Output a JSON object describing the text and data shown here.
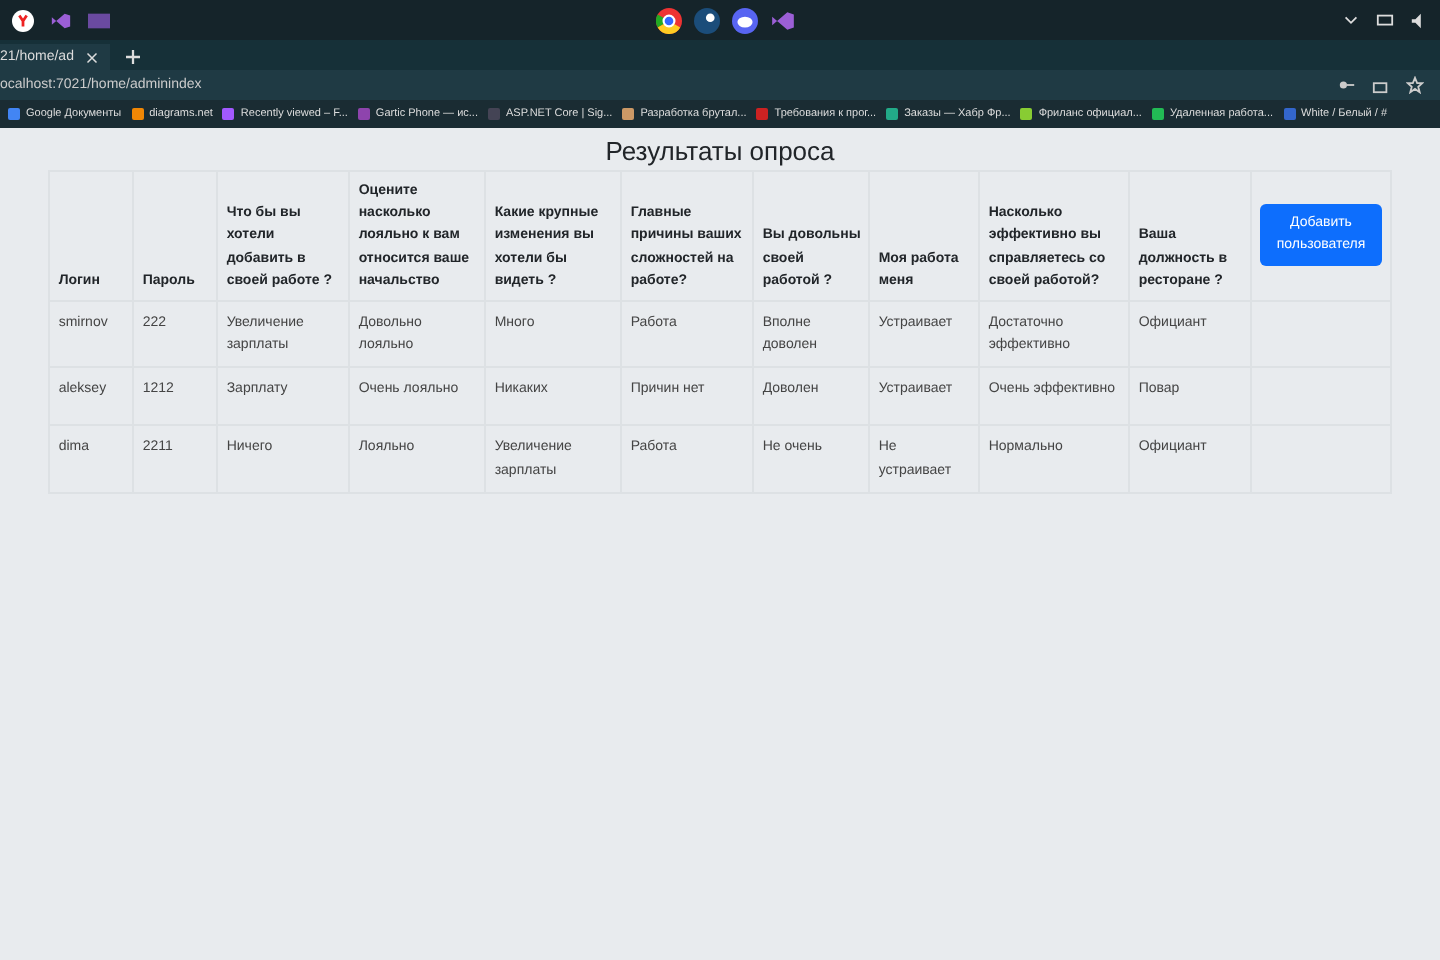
{
  "browser": {
    "tab_title": "21/home/ad",
    "address": "ocalhost:7021/home/adminindex",
    "bookmarks": [
      "Google Документы",
      "diagrams.net",
      "Recently viewed – F...",
      "Gartic Phone — ис...",
      "ASP.NET Core | Sig...",
      "Разработка брутал...",
      "Требования к прог...",
      "Заказы — Хабр Фр...",
      "Фриланс официал...",
      "Удаленная работа...",
      "White / Белый / #"
    ]
  },
  "page": {
    "title": "Результаты опроса",
    "table": {
      "columns": [
        "Логин",
        "Пароль",
        "Что бы вы хотели добавить в своей работе ?",
        "Оцените насколько лояльно к вам относится ваше начальство",
        "Какие крупные изменения вы хотели бы видеть ?",
        "Главные причины ваших сложностей на работе?",
        "Вы довольны своей работой ?",
        "Моя работа меня",
        "Насколько эффективно вы справляетесь со своей работой?",
        "Ваша должность в ресторане ?"
      ],
      "add_button": "Добавить пользователя",
      "rows": [
        [
          "smirnov",
          "222",
          "Увеличение зарплаты",
          "Довольно лояльно",
          "Много",
          "Работа",
          "Вполне доволен",
          "Устраивает",
          "Достаточно эффективно",
          "Официант"
        ],
        [
          "aleksey",
          "1212",
          "Зарплату",
          "Очень лояльно",
          "Никаких",
          "Причин нет",
          "Доволен",
          "Устраивает",
          "Очень эффективно",
          "Повар"
        ],
        [
          "dima",
          "2211",
          "Ничего",
          "Лояльно",
          "Увеличение зарплаты",
          "Работа",
          "Не очень",
          "Не устраивает",
          "Нормально",
          "Официант"
        ]
      ]
    }
  }
}
